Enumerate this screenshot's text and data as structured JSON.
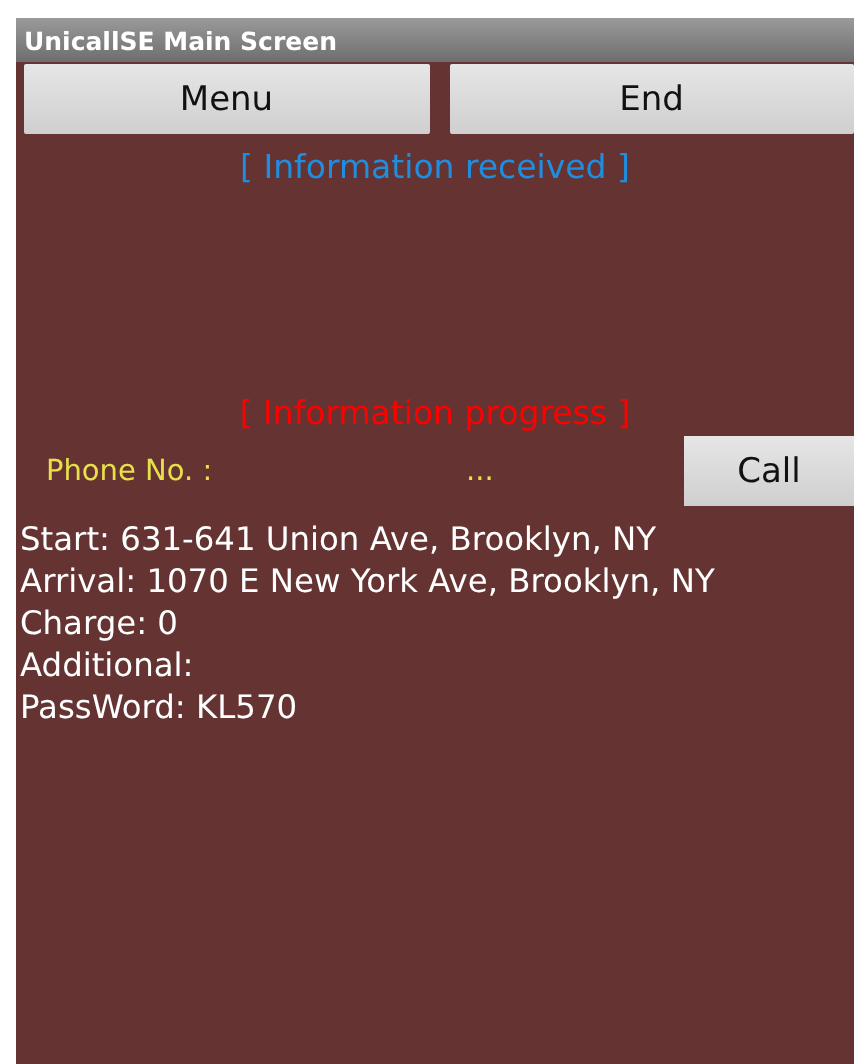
{
  "window": {
    "title": "UnicallSE Main Screen"
  },
  "buttons": [
    {
      "label": "Menu"
    },
    {
      "label": "End"
    }
  ],
  "received_header": "[ Information received ]",
  "progress_header": "[ Information progress ]",
  "phone": {
    "label": "Phone No. :",
    "value": "...",
    "button": "Call"
  },
  "details": [
    "Start: 631-641 Union Ave, Brooklyn, NY",
    "Arrival: 1070 E New York Ave, Brooklyn, NY",
    "Charge: 0",
    "Additional:",
    "PassWord: KL570"
  ]
}
